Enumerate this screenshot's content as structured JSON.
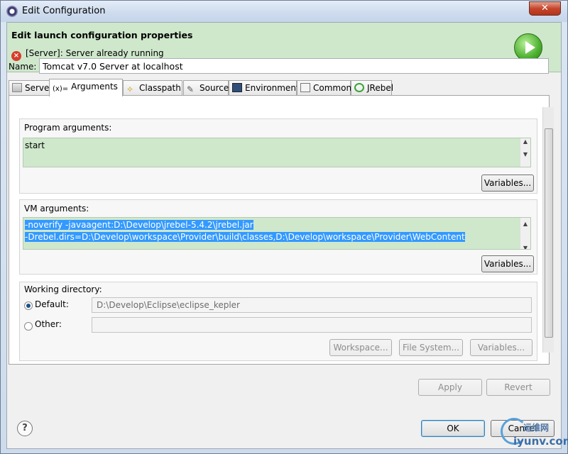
{
  "window": {
    "title": "Edit Configuration",
    "close_label": "✕"
  },
  "header": {
    "title": "Edit launch configuration properties",
    "status": "[Server]: Server already running"
  },
  "name_field": {
    "label": "Name:",
    "value": "Tomcat v7.0 Server at localhost"
  },
  "tabs": [
    {
      "label": "Server"
    },
    {
      "label": "Arguments"
    },
    {
      "label": "Classpath"
    },
    {
      "label": "Source"
    },
    {
      "label": "Environment"
    },
    {
      "label": "Common"
    },
    {
      "label": "JRebel"
    }
  ],
  "program_arguments": {
    "label": "Program arguments:",
    "value": "start",
    "variables_label": "Variables..."
  },
  "vm_arguments": {
    "label": "VM arguments:",
    "line1": "-noverify -javaagent:D:\\Develop\\jrebel-5.4.2\\jrebel.jar",
    "line2": "-Drebel.dirs=D:\\Develop\\workspace\\Provider\\build\\classes,D:\\Develop\\workspace\\Provider\\WebContent",
    "variables_label": "Variables..."
  },
  "working_directory": {
    "label": "Working directory:",
    "default_label": "Default:",
    "default_value": "D:\\Develop\\Eclipse\\eclipse_kepler",
    "other_label": "Other:",
    "other_value": "",
    "workspace_label": "Workspace...",
    "filesystem_label": "File System...",
    "variables_label": "Variables..."
  },
  "actions": {
    "apply": "Apply",
    "revert": "Revert",
    "ok": "OK",
    "cancel": "Cancel"
  },
  "help": {
    "label": "?"
  },
  "watermark": {
    "line1": "运维网",
    "line2": "iyunv.com"
  }
}
